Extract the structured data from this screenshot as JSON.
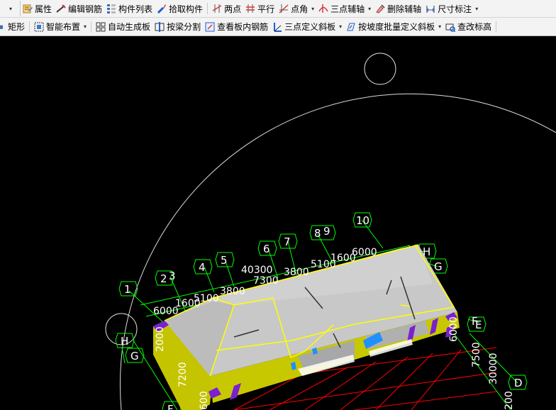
{
  "toolbar_row1": {
    "leading_dropdown": "▾",
    "items": [
      {
        "label": "属性",
        "icon": "properties-icon"
      },
      {
        "label": "编辑钢筋",
        "icon": "edit-rebar-icon"
      },
      {
        "label": "构件列表",
        "icon": "component-list-icon"
      },
      {
        "label": "拾取构件",
        "icon": "pick-component-icon"
      },
      {
        "label": "两点",
        "icon": "two-point-axis-icon"
      },
      {
        "label": "平行",
        "icon": "parallel-axis-icon"
      },
      {
        "label": "点角",
        "icon": "point-angle-axis-icon",
        "dropdown": true
      },
      {
        "label": "三点辅轴",
        "icon": "three-point-axis-icon",
        "dropdown": true
      },
      {
        "label": "删除辅轴",
        "icon": "delete-axis-icon"
      },
      {
        "label": "尺寸标注",
        "icon": "dimension-icon",
        "dropdown": true
      }
    ]
  },
  "toolbar_row2": {
    "items": [
      {
        "label": "矩形",
        "icon": "rectangle-icon"
      },
      {
        "label": "智能布置",
        "icon": "smart-layout-icon",
        "dropdown": true
      },
      {
        "label": "自动生成板",
        "icon": "auto-generate-slab-icon"
      },
      {
        "label": "按梁分割",
        "icon": "split-by-beam-icon"
      },
      {
        "label": "查看板内钢筋",
        "icon": "view-slab-rebar-icon"
      },
      {
        "label": "三点定义斜板",
        "icon": "three-point-sloped-slab-icon",
        "dropdown": true
      },
      {
        "label": "按坡度批量定义斜板",
        "icon": "batch-slope-slab-icon",
        "dropdown": true
      },
      {
        "label": "查改标高",
        "icon": "edit-elevation-icon"
      }
    ]
  },
  "viewport": {
    "axis_labels": [
      "1",
      "2",
      "3",
      "4",
      "5",
      "6",
      "7",
      "8",
      "9",
      "10",
      "H",
      "G",
      "H",
      "G",
      "F",
      "E",
      "D",
      "F"
    ],
    "dimensions": [
      "6000",
      "1600",
      "5100",
      "3800",
      "40300",
      "7300",
      "3800",
      "5100",
      "1600",
      "6000",
      "2000",
      "7200",
      "7500",
      "30000",
      "6000",
      "200",
      "600"
    ],
    "colors": {
      "background": "#000000",
      "roof": "#c8c8c8",
      "wall": "#c8c800",
      "grid_line": "#00ff00",
      "red_axis": "#ff0000",
      "highlight": "#ffff00",
      "beam_purple": "#7b1fd0",
      "beam_blue": "#1e90ff",
      "orbit_circle": "#ffffff"
    }
  }
}
